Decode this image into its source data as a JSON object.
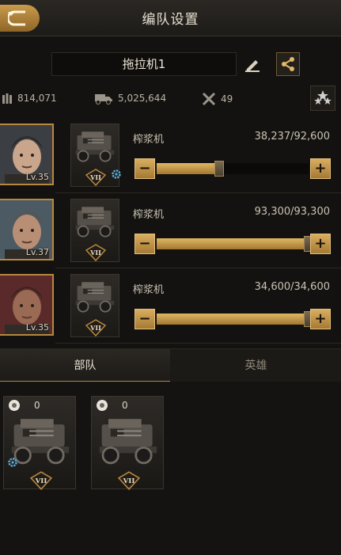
{
  "header": {
    "title": "编队设置",
    "back_icon": "back-arrow-icon"
  },
  "formation": {
    "name": "拖拉机1"
  },
  "stats": {
    "troops": "814,071",
    "load": "5,025,644",
    "repair": "49"
  },
  "squads": [
    {
      "hero_level": "Lv.35",
      "unit_name": "榨浆机",
      "count": "38,237/92,600",
      "fill": 0.41,
      "has_gear": true
    },
    {
      "hero_level": "Lv.37",
      "unit_name": "榨浆机",
      "count": "93,300/93,300",
      "fill": 1.0,
      "has_gear": false
    },
    {
      "hero_level": "Lv.35",
      "unit_name": "榨浆机",
      "count": "34,600/34,600",
      "fill": 1.0,
      "has_gear": false
    }
  ],
  "controls": {
    "minus": "−",
    "plus": "+"
  },
  "tabs": [
    {
      "label": "部队",
      "active": true
    },
    {
      "label": "英雄",
      "active": false
    }
  ],
  "reserve": [
    {
      "count": "0",
      "tier": "VII",
      "has_gear": true
    },
    {
      "count": "0",
      "tier": "VII",
      "has_gear": false
    }
  ],
  "unit_tier": "VII",
  "colors": {
    "accent": "#b8873f",
    "gold_fill": "#e0b764",
    "background": "#141210"
  }
}
